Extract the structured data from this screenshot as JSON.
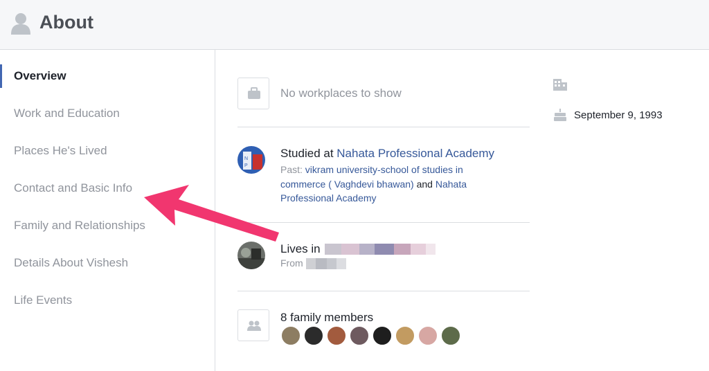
{
  "header": {
    "title": "About",
    "icon": "user-silhouette-icon"
  },
  "sidebar": {
    "items": [
      {
        "label": "Overview",
        "active": true
      },
      {
        "label": "Work and Education",
        "active": false
      },
      {
        "label": "Places He's Lived",
        "active": false
      },
      {
        "label": "Contact and Basic Info",
        "active": false
      },
      {
        "label": "Family and Relationships",
        "active": false
      },
      {
        "label": "Details About Vishesh",
        "active": false
      },
      {
        "label": "Life Events",
        "active": false
      }
    ],
    "accent_color": "#4267b2"
  },
  "main": {
    "work": {
      "icon": "briefcase-icon",
      "text": "No workplaces to show"
    },
    "education": {
      "prefix": "Studied at ",
      "school": "Nahata Professional Academy",
      "past_prefix": "Past: ",
      "past_school_1_line1": "vikram university-school of studies in",
      "past_school_1_line2": "commerce ( Vaghdevi bhawan)",
      "past_and": " and ",
      "past_school_2_line1": "Nahata",
      "past_school_2_line2": "Professional Academy"
    },
    "lives": {
      "lives_prefix": "Lives in",
      "from_prefix": "From"
    },
    "family": {
      "icon": "family-icon",
      "text": "8 family members",
      "member_count": 8
    }
  },
  "right": {
    "building_icon": "building-icon",
    "cake_icon": "birthday-cake-icon",
    "birthday": "September 9, 1993"
  },
  "annotation": {
    "arrow_color": "#f1366f"
  }
}
